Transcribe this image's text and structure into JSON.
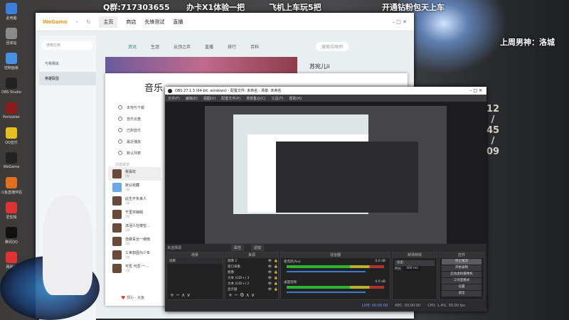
{
  "overlay": {
    "qq_group": "Q群:717303655",
    "promo1": "办卡X1体验一把",
    "promo2": "飞机上车玩5把",
    "promo3": "开通钻粉包天上车",
    "weekly_star": "上周男神：洛城"
  },
  "clock": {
    "hour": "12",
    "sep": "/",
    "minute": "45",
    "second": "09"
  },
  "desktop_icons": [
    {
      "label": "此电脑"
    },
    {
      "label": "回收站"
    },
    {
      "label": "控制面板"
    },
    {
      "label": "OBS Studio"
    },
    {
      "label": "Pentablet"
    },
    {
      "label": "QQ音乐"
    },
    {
      "label": "WeGame"
    },
    {
      "label": "斗鱼直播伴侣"
    },
    {
      "label": "爱剪辑"
    },
    {
      "label": "腾讯QQ"
    },
    {
      "label": "网易云"
    }
  ],
  "wegame": {
    "logo": "WeGame",
    "tabs": [
      "主页",
      "商店",
      "先锋测试",
      "直播"
    ],
    "sidebar": {
      "search_placeholder": "搜索应用",
      "items": [
        "与我相关",
        "英雄联盟"
      ]
    },
    "nav": [
      "资讯",
      "生涯",
      "云顶之弈",
      "直播",
      "排行",
      "百科"
    ],
    "search_placeholder": "搜索召唤师",
    "streamer": "苏宛儿ii"
  },
  "music": {
    "title": "音乐",
    "menu": [
      "本地与下载",
      "音乐云盘",
      "已购音乐",
      "最近播放",
      "默认列表"
    ],
    "section": "创建歌单",
    "playlists": [
      {
        "name": "我喜欢",
        "count": "0首"
      },
      {
        "name": "默认收藏",
        "count": "1首"
      },
      {
        "name": "此生不负良人",
        "count": "1首"
      },
      {
        "name": "千里共婵娟",
        "count": "1首"
      },
      {
        "name": "流泪人在楼空...",
        "count": "1首"
      },
      {
        "name": "自做青丝一缕雨",
        "count": "1首"
      },
      {
        "name": "三世如因为少年",
        "count": "1首"
      },
      {
        "name": "可否 可否 一...",
        "count": "1首"
      }
    ],
    "now_playing": "郭沁 - 大鱼"
  },
  "obs": {
    "title": "OBS 27.1.3 (64-bit, windows) - 配置文件: 未命名 - 场景: 未命名",
    "menu": [
      "文件(F)",
      "编辑(E)",
      "视图(V)",
      "配置文件(P)",
      "场景集合(C)",
      "工具(T)",
      "帮助(H)"
    ],
    "no_source": "未选择源",
    "properties": "属性",
    "filters": "滤镜",
    "docks": {
      "scenes": "场景",
      "sources": "来源",
      "mixer": "混音器",
      "transitions": "转场特效",
      "controls": "控件"
    },
    "scene_items": [
      "场景"
    ],
    "sources": [
      "图像 2",
      "窗口采集",
      "图像",
      "文本 (GDI+) 3",
      "文本 (GDI+) 2",
      "显示器"
    ],
    "mixer": [
      {
        "name": "麦克风/Aux",
        "db": "0.0 dB"
      },
      {
        "name": "桌面音频",
        "db": "0.0 dB"
      }
    ],
    "transition": "淡出",
    "duration_label": "时长",
    "duration": "300 ms",
    "controls": [
      "停止推流",
      "开始录制",
      "启动虚拟摄像机",
      "工作室模式",
      "设置",
      "退出"
    ],
    "status": {
      "live": "LIVE: 00:00:00",
      "rec": "REC: 00:00:00",
      "cpu": "CPU: 1.4%, 30.00 fps"
    }
  }
}
